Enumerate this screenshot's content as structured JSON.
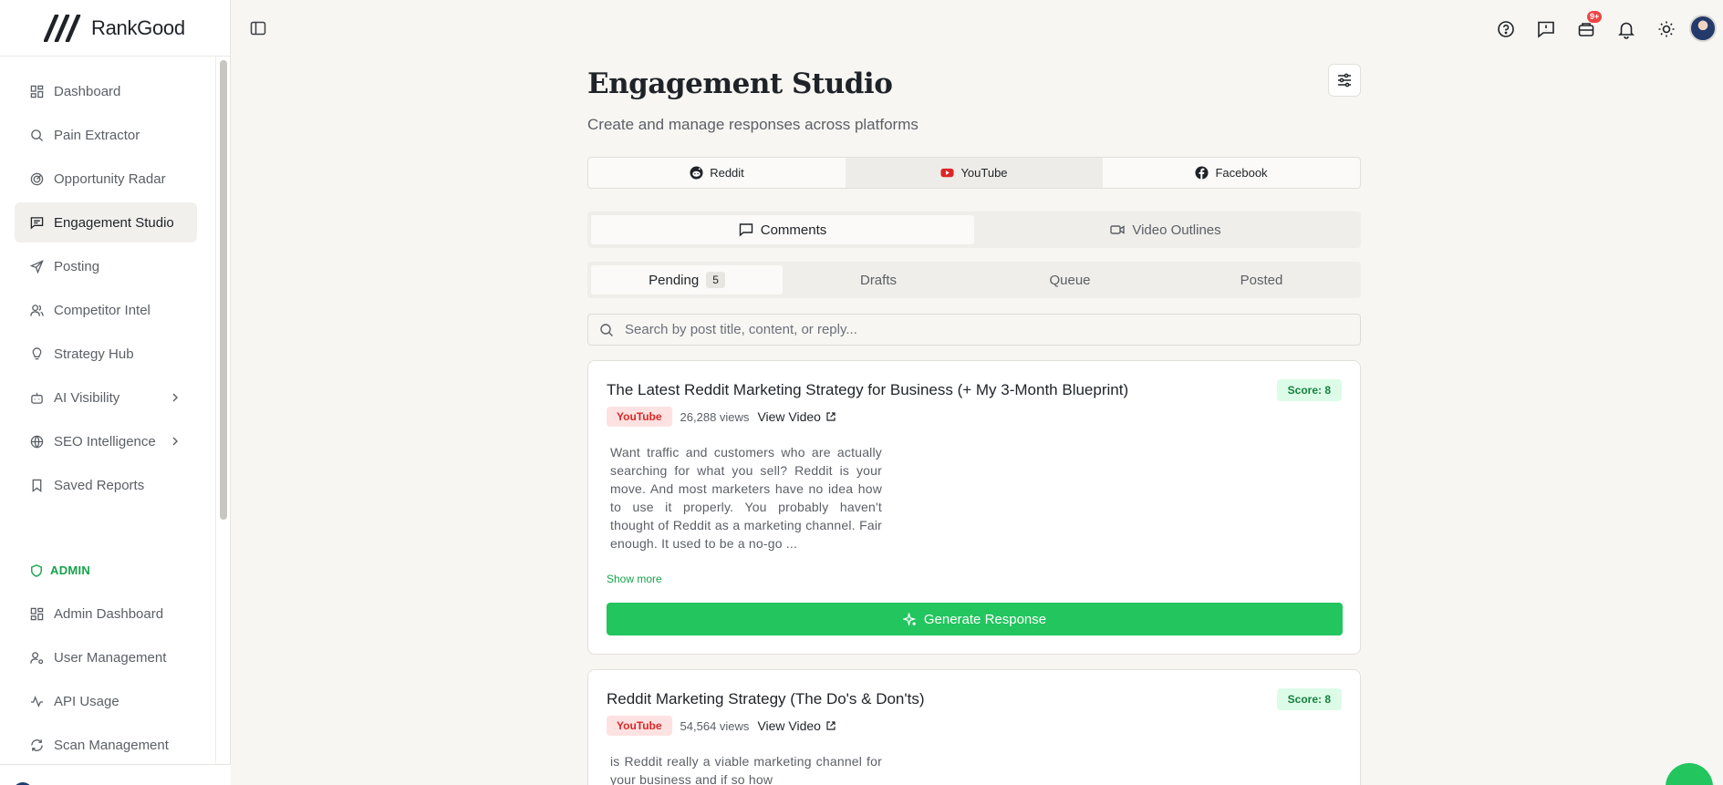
{
  "brand": {
    "name": "RankGood"
  },
  "sidebar": {
    "items": [
      {
        "label": "Dashboard",
        "icon": "dashboard-icon"
      },
      {
        "label": "Pain Extractor",
        "icon": "search-icon"
      },
      {
        "label": "Opportunity Radar",
        "icon": "radar-icon"
      },
      {
        "label": "Engagement Studio",
        "icon": "message-square-icon",
        "active": true
      },
      {
        "label": "Posting",
        "icon": "send-icon"
      },
      {
        "label": "Competitor Intel",
        "icon": "users-icon"
      },
      {
        "label": "Strategy Hub",
        "icon": "lightbulb-icon"
      },
      {
        "label": "AI Visibility",
        "icon": "bot-icon",
        "expandable": true
      },
      {
        "label": "SEO Intelligence",
        "icon": "globe-icon",
        "expandable": true
      },
      {
        "label": "Saved Reports",
        "icon": "bookmark-icon"
      }
    ],
    "admin_label": "ADMIN",
    "admin_items": [
      {
        "label": "Admin Dashboard",
        "icon": "dashboard-icon"
      },
      {
        "label": "User Management",
        "icon": "user-cog-icon"
      },
      {
        "label": "API Usage",
        "icon": "activity-icon"
      },
      {
        "label": "Scan Management",
        "icon": "refresh-icon"
      }
    ]
  },
  "topbar": {
    "icons": [
      "help-icon",
      "feedback-icon",
      "inbox-icon",
      "bell-icon",
      "sun-icon"
    ],
    "inbox_badge": "9+"
  },
  "page": {
    "title": "Engagement Studio",
    "subtitle": "Create and manage responses across platforms"
  },
  "platform_tabs": [
    {
      "label": "Reddit",
      "icon": "reddit-icon"
    },
    {
      "label": "YouTube",
      "icon": "youtube-icon",
      "active": true
    },
    {
      "label": "Facebook",
      "icon": "facebook-icon"
    }
  ],
  "content_tabs": [
    {
      "label": "Comments",
      "icon": "message-icon",
      "active": true
    },
    {
      "label": "Video Outlines",
      "icon": "video-icon"
    }
  ],
  "status_tabs": [
    {
      "label": "Pending",
      "count": "5",
      "active": true
    },
    {
      "label": "Drafts"
    },
    {
      "label": "Queue"
    },
    {
      "label": "Posted"
    }
  ],
  "search": {
    "placeholder": "Search by post title, content, or reply..."
  },
  "cards": [
    {
      "title": "The Latest Reddit Marketing Strategy for Business (+ My 3-Month Blueprint)",
      "score": "Score: 8",
      "platform": "YouTube",
      "views": "26,288 views",
      "link": "View Video",
      "description": "Want traffic and customers who are actually searching for what you sell? Reddit is your move. And most marketers have no idea how to use it properly. You probably haven't thought of Reddit as a marketing channel. Fair enough. It used to be a no-go ...",
      "show_more": "Show more",
      "button": "Generate Response"
    },
    {
      "title": "Reddit Marketing Strategy (The Do's & Don'ts)",
      "score": "Score: 8",
      "platform": "YouTube",
      "views": "54,564 views",
      "link": "View Video",
      "description": "is Reddit really a viable marketing channel for your business and if so how"
    }
  ],
  "colors": {
    "accent": "#22c55e",
    "youtube": "#dc2626"
  }
}
